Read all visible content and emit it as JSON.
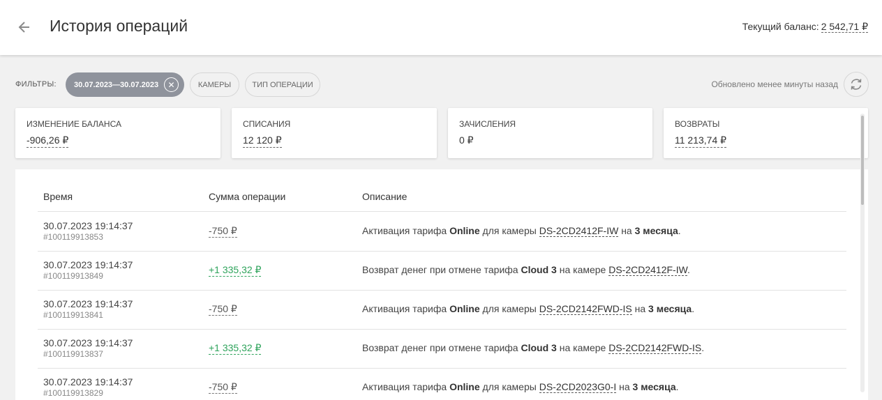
{
  "header": {
    "title": "История операций",
    "balance_label": "Текущий баланс:",
    "balance_value": "2 542,71 ₽"
  },
  "filters": {
    "label": "ФИЛЬТРЫ:",
    "date_chip": "30.07.2023—30.07.2023",
    "cameras_chip": "КАМЕРЫ",
    "type_chip": "ТИП ОПЕРАЦИИ",
    "updated_text": "Обновлено менее минуты назад"
  },
  "summary": [
    {
      "label": "ИЗМЕНЕНИЕ БАЛАНСА",
      "value": "-906,26 ₽"
    },
    {
      "label": "СПИСАНИЯ",
      "value": "12 120 ₽"
    },
    {
      "label": "ЗАЧИСЛЕНИЯ",
      "value": "0 ₽"
    },
    {
      "label": "ВОЗВРАТЫ",
      "value": "11 213,74 ₽"
    }
  ],
  "table": {
    "columns": [
      "Время",
      "Сумма операции",
      "Описание"
    ],
    "rows": [
      {
        "time": "30.07.2023 19:14:37",
        "id": "#100119913853",
        "amount": "-750 ₽",
        "d1": "Активация тарифа ",
        "d2": "Online",
        "d3": " для камеры ",
        "cam": "DS-2CD2412F-IW",
        "d4": " на ",
        "d5": "3 месяца",
        "d6": "."
      },
      {
        "time": "30.07.2023 19:14:37",
        "id": "#100119913849",
        "amount": "+1 335,32 ₽",
        "d1": "Возврат денег при отмене тарифа ",
        "d2": "Cloud 3",
        "d3": " на камере ",
        "cam": "DS-2CD2412F-IW",
        "d4": "",
        "d5": "",
        "d6": "."
      },
      {
        "time": "30.07.2023 19:14:37",
        "id": "#100119913841",
        "amount": "-750 ₽",
        "d1": "Активация тарифа ",
        "d2": "Online",
        "d3": " для камеры ",
        "cam": "DS-2CD2142FWD-IS",
        "d4": " на ",
        "d5": "3 месяца",
        "d6": "."
      },
      {
        "time": "30.07.2023 19:14:37",
        "id": "#100119913837",
        "amount": "+1 335,32 ₽",
        "d1": "Возврат денег при отмене тарифа ",
        "d2": "Cloud 3",
        "d3": " на камере ",
        "cam": "DS-2CD2142FWD-IS",
        "d4": "",
        "d5": "",
        "d6": "."
      },
      {
        "time": "30.07.2023 19:14:37",
        "id": "#100119913829",
        "amount": "-750 ₽",
        "d1": "Активация тарифа ",
        "d2": "Online",
        "d3": " для камеры ",
        "cam": "DS-2CD2023G0-I",
        "d4": " на ",
        "d5": "3 месяца",
        "d6": "."
      }
    ]
  },
  "colors": {
    "positive": "#2ea35b",
    "chip_active": "#8f939c",
    "header_bg": "#ffffff",
    "page_bg": "#f1f1f1"
  },
  "icons": {
    "back": "arrow-left-icon",
    "chip_close": "close-icon",
    "refresh": "refresh-icon"
  }
}
